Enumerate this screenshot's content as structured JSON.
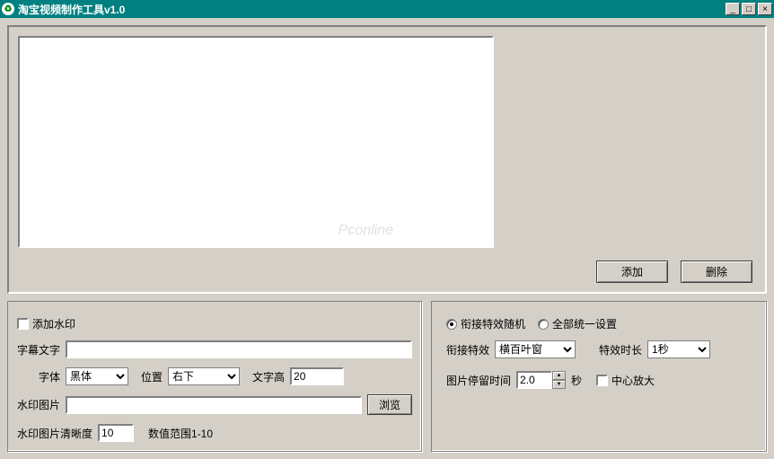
{
  "title": "淘宝视频制作工具v1.0",
  "watermark_logo_text": "Pconline",
  "buttons": {
    "add": "添加",
    "delete": "删除",
    "browse": "浏览"
  },
  "watermark": {
    "add_label": "添加水印",
    "text_label": "字幕文字",
    "text_value": "",
    "font_label": "字体",
    "font_value": "黑体",
    "position_label": "位置",
    "position_value": "右下",
    "height_label": "文字高",
    "height_value": "20",
    "image_label": "水印图片",
    "image_value": "",
    "sharpness_label": "水印图片清晰度",
    "sharpness_value": "10",
    "sharpness_hint": "数值范围1-10"
  },
  "effects": {
    "random_label": "衔接特效随机",
    "unified_label": "全部统一设置",
    "effect_label": "衔接特效",
    "effect_value": "横百叶窗",
    "duration_label": "特效时长",
    "duration_value": "1秒",
    "stay_label": "图片停留时间",
    "stay_value": "2.0",
    "stay_unit": "秒",
    "zoom_label": "中心放大"
  }
}
